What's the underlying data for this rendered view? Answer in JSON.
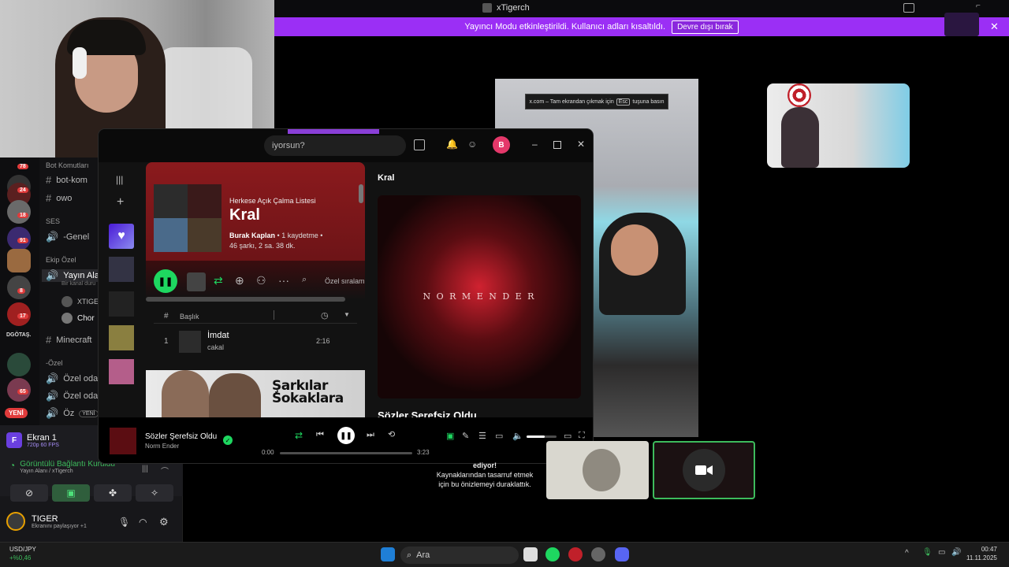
{
  "window_title": "xTigerch",
  "banner": {
    "message": "Yayıncı Modu etkinleştirildi. Kullanıcı adları kısaltıldı.",
    "button": "Devre dışı bırak"
  },
  "esc_hint": {
    "prefix": "x.com – Tam ekrandan çıkmak için",
    "key": "Esc",
    "suffix": "tuşuna basın"
  },
  "discord": {
    "guild_badges": [
      "78",
      "24",
      "18",
      "91",
      "8",
      "17",
      "65"
    ],
    "guild_text": "DGÖTAŞ.",
    "new_badge": "YENİ",
    "channels": {
      "cat_bot": "Bot Komutları",
      "bot_kom": "bot-kom",
      "owo": "owo",
      "cat_ses": "SES",
      "genel": "-Genel",
      "cat_ekip": "Ekip Özel",
      "yayin": "Yayın Alanı",
      "yayin_sub": "Bir kanal duru",
      "member1": "XTIGER",
      "member2": "Chor",
      "minecraft": "Minecraft",
      "cat_ozel": "-Özel",
      "oda1": "Özel oda 1",
      "oda2": "Özel oda 2",
      "oda3": "Öz",
      "yeni_pill": "YENİ"
    },
    "screen": {
      "letter": "F",
      "title": "Ekran 1",
      "quality": "720p 60 FPS"
    },
    "voice": {
      "status": "Görüntülü Bağlantı Kuruldu",
      "channel": "Yayın Alanı",
      "user": "/ xTigerch"
    },
    "user": {
      "name": "TIGER",
      "status": "Ekranını paylaşıyor +1"
    }
  },
  "spotify": {
    "search_placeholder": "iyorsun?",
    "avatar_letter": "B",
    "playlist": {
      "type": "Herkese Açık Çalma Listesi",
      "name": "Kral",
      "owner": "Burak Kaplan",
      "saves": "1 kaydetme",
      "stats": "46 şarkı, 2 sa. 38 dk.",
      "sort": "Özel sıralam"
    },
    "table": {
      "col_num": "#",
      "col_title": "Başlık"
    },
    "tracks": [
      {
        "num": "1",
        "title": "İmdat",
        "artist": "cakal",
        "duration": "2:16"
      }
    ],
    "promo": {
      "line1": "Şarkılar",
      "line2": "Sokaklara"
    },
    "now_playing_header": "Kral",
    "now_playing_art_text": "N O R M   E N D E R",
    "now_playing_title_big": "Sözler Şerefsiz Oldu",
    "player": {
      "title": "Sözler Şerefsiz Oldu",
      "artist": "Norm Ender",
      "elapsed": "0:00",
      "total": "3:23",
      "progress": 0.0,
      "volume": 0.6
    }
  },
  "stream_overlay": {
    "paused_line1": "ediyor!",
    "paused_line2": "Kaynaklarından tasarruf etmek",
    "paused_line3": "için bu önizlemeyi duraklattık."
  },
  "taskbar": {
    "search": "Ara",
    "ticker_name": "USD/JPY",
    "ticker_value": "+%0,46",
    "time": "00:47",
    "date": "11.11.2025"
  },
  "colors": {
    "streamer_banner": "#9b2ff5",
    "spotify_green": "#1ed760",
    "header_red": "#8b1a1d"
  }
}
